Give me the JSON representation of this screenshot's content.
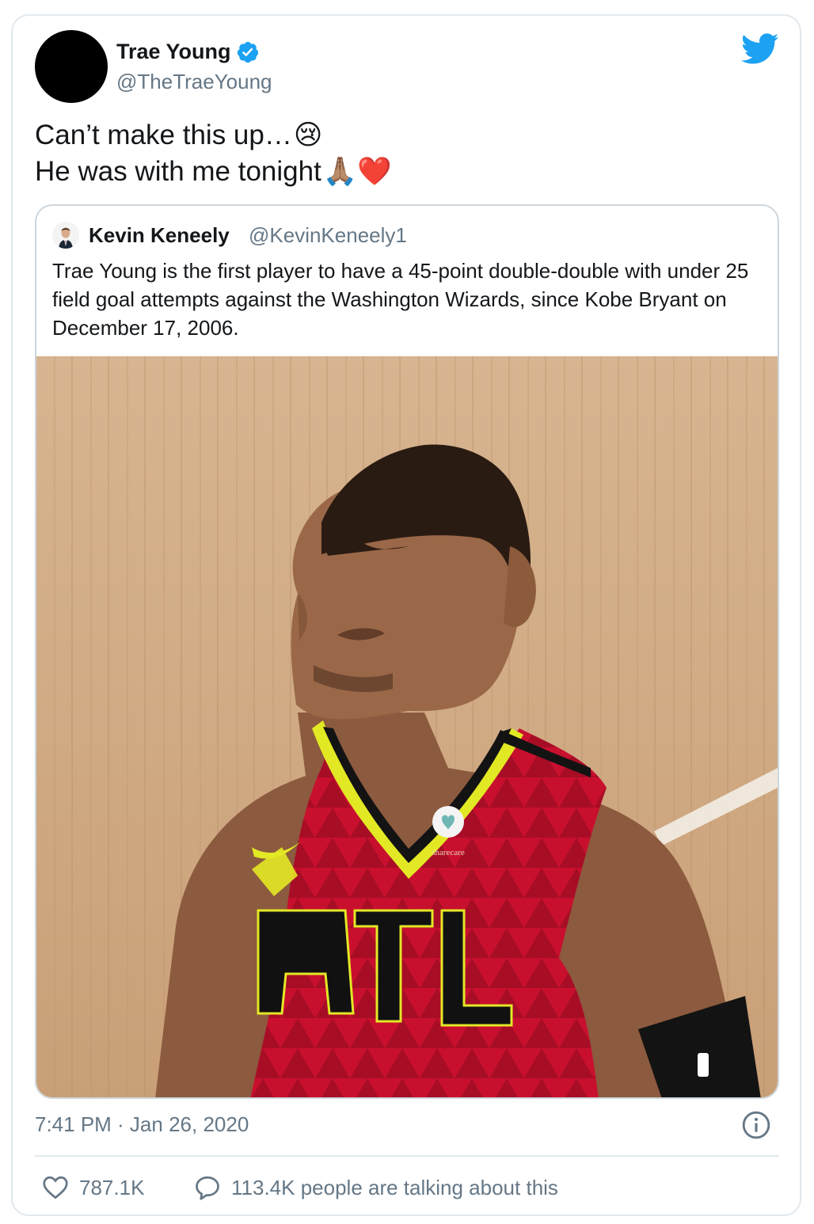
{
  "tweet": {
    "author_name": "Trae Young",
    "author_handle": "@TheTraeYoung",
    "lines": [
      "Can’t make this up…",
      "He was with me tonight"
    ],
    "line_emojis": [
      "😢",
      "🙏🏽❤️"
    ],
    "timestamp": "7:41 PM · Jan 26, 2020",
    "likes": "787.1K",
    "conversation": "113.4K people are talking about this"
  },
  "quoted_tweet": {
    "author_name": "Kevin Keneely",
    "author_handle": "@KevinKeneely1",
    "text": "Trae Young is the first player to have a 45-point double-double with under 25 field goal attempts against the Washington Wizards, since Kobe Bryant on December 17, 2006.",
    "image": {
      "jersey_text": "ATL",
      "sponsor_text": "sharecare"
    }
  },
  "icons": {
    "brand": "twitter-bird-icon",
    "verified": "verified-badge-icon",
    "info": "info-icon",
    "like": "heart-icon",
    "reply": "speech-bubble-icon"
  },
  "colors": {
    "brand_blue": "#1da1f2",
    "text": "#14171a",
    "secondary_text": "#657786",
    "border": "#e1e8ed",
    "jersey_red": "#c8102e",
    "jersey_yellow": "#e3e825"
  }
}
